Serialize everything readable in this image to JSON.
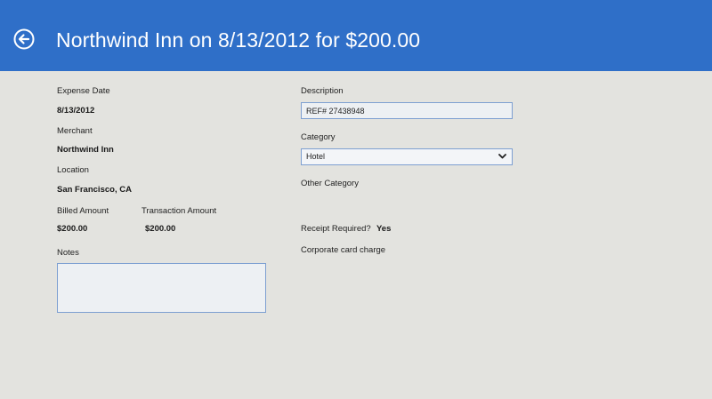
{
  "header": {
    "title": "Northwind Inn on 8/13/2012 for $200.00",
    "back_icon": "back-arrow-circle-icon",
    "background": "#2f6fc8"
  },
  "left": {
    "expense_date_label": "Expense Date",
    "expense_date_value": "8/13/2012",
    "merchant_label": "Merchant",
    "merchant_value": "Northwind Inn",
    "location_label": "Location",
    "location_value": "San Francisco, CA",
    "billed_amount_label": "Billed Amount",
    "billed_amount_value": "$200.00",
    "transaction_amount_label": "Transaction Amount",
    "transaction_amount_value": "$200.00",
    "notes_label": "Notes",
    "notes_value": ""
  },
  "right": {
    "description_label": "Description",
    "description_value": "REF# 27438948",
    "category_label": "Category",
    "category_selected": "Hotel",
    "other_category_label": "Other Category",
    "receipt_required_label": "Receipt Required?",
    "receipt_required_value": "Yes",
    "corporate_card_text": "Corporate card charge"
  },
  "colors": {
    "accent": "#2f6fc8",
    "field_border": "#7d9fd1",
    "background": "#e3e3df"
  }
}
